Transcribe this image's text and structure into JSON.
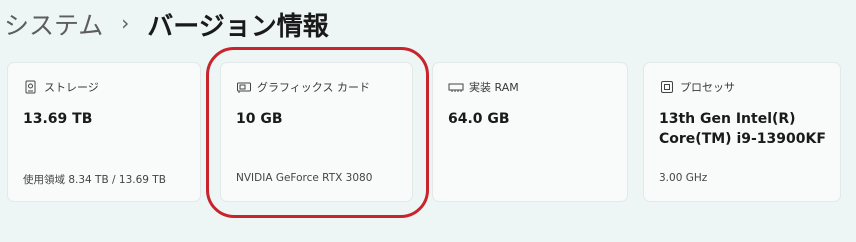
{
  "breadcrumb": {
    "parent": "システム",
    "separator": "›",
    "current": "バージョン情報"
  },
  "cards": [
    {
      "icon": "storage-icon",
      "label": "ストレージ",
      "value": "13.69 TB",
      "sub": "使用領域 8.34 TB / 13.69 TB"
    },
    {
      "icon": "graphics-card-icon",
      "label": "グラフィックス カード",
      "value": "10 GB",
      "sub": "NVIDIA GeForce RTX 3080"
    },
    {
      "icon": "ram-icon",
      "label": "実装 RAM",
      "value": "64.0 GB",
      "sub": ""
    },
    {
      "icon": "processor-icon",
      "label": "プロセッサ",
      "value_line1": "13th Gen Intel(R)",
      "value_line2": "Core(TM) i9-13900KF",
      "sub": "3.00 GHz"
    }
  ],
  "colors": {
    "background": "#eef5f5",
    "card": "#f9fbfb",
    "highlight": "#c8242b"
  }
}
